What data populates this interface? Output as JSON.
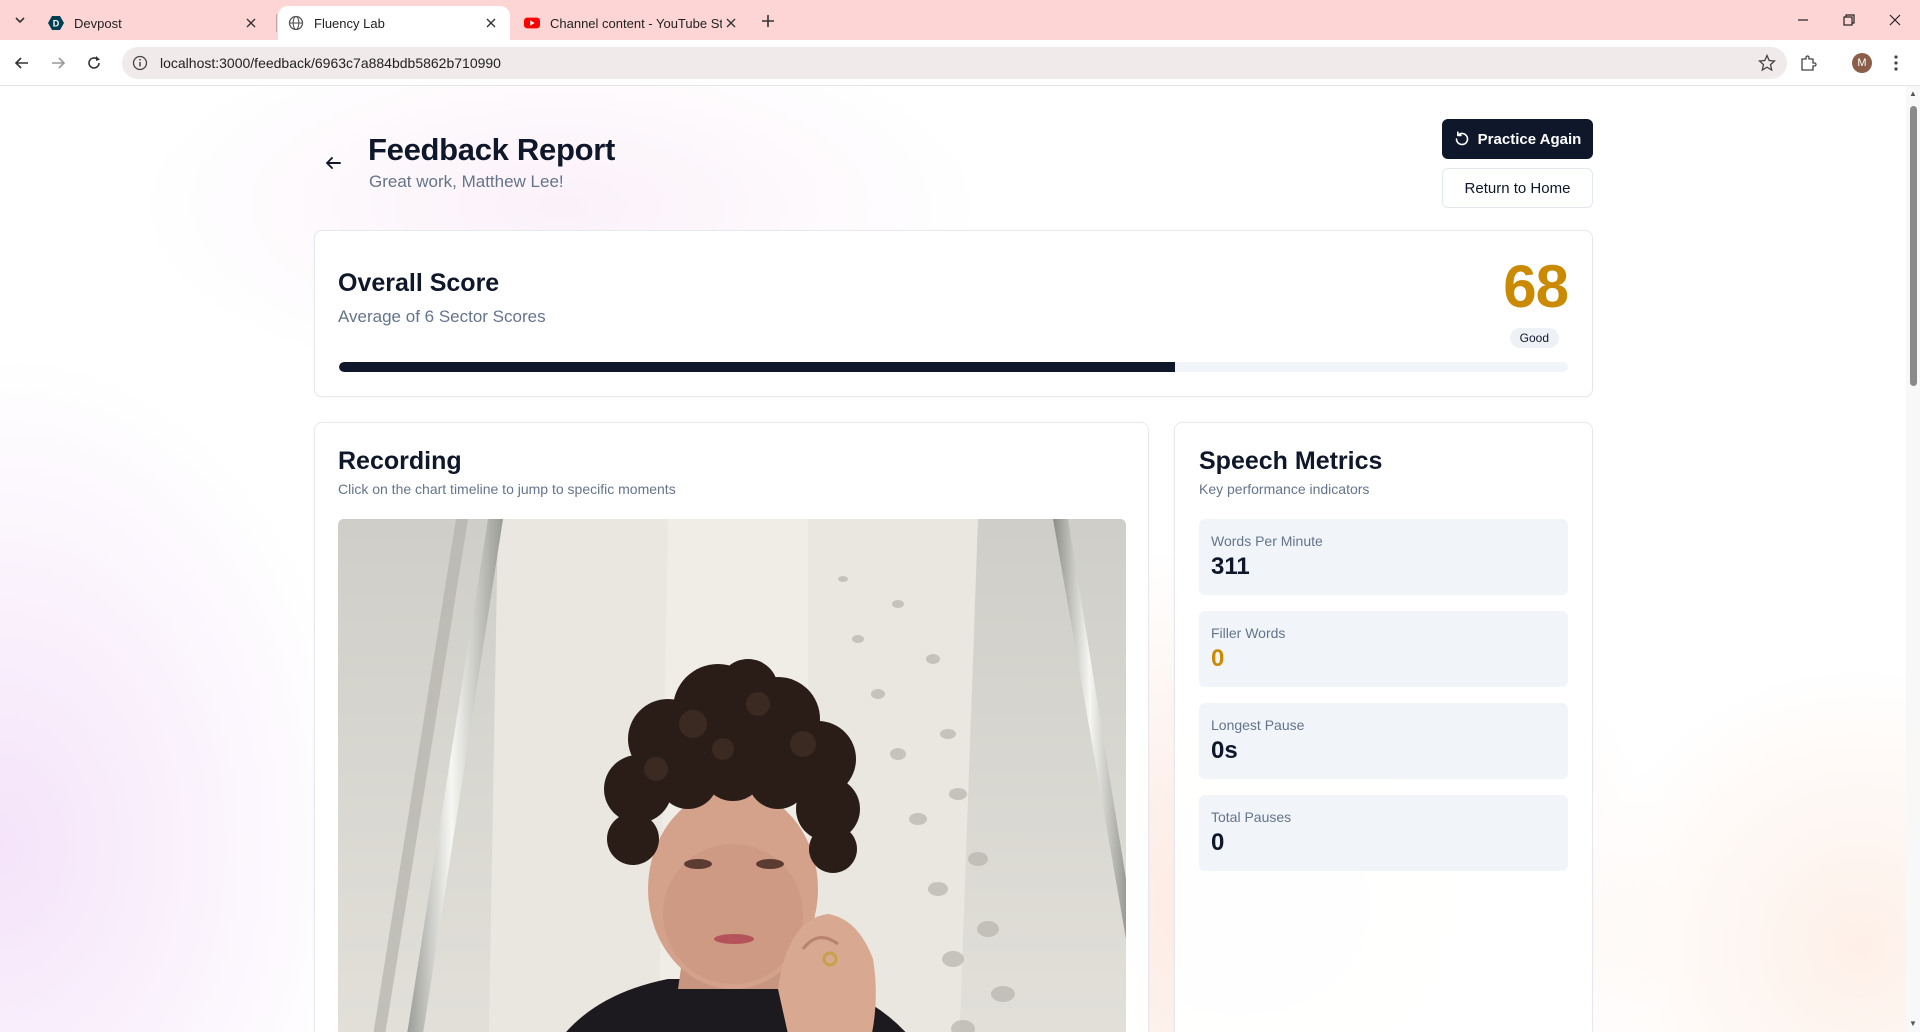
{
  "browser": {
    "tabs": [
      {
        "title": "Devpost",
        "favicon": "devpost-icon",
        "active": false
      },
      {
        "title": "Fluency Lab",
        "favicon": "globe-icon",
        "active": true
      },
      {
        "title": "Channel content - YouTube Stu",
        "favicon": "youtube-icon",
        "active": false
      }
    ],
    "url": "localhost:3000/feedback/6963c7a884bdb5862b710990",
    "profile_initial": "M"
  },
  "header": {
    "title": "Feedback Report",
    "subtitle": "Great work, Matthew Lee!",
    "practice_again_label": "Practice Again",
    "return_home_label": "Return to Home"
  },
  "overall": {
    "title": "Overall Score",
    "subtitle": "Average of 6 Sector Scores",
    "score": "68",
    "rating": "Good",
    "progress_percent": 68
  },
  "recording": {
    "title": "Recording",
    "subtitle": "Click on the chart timeline to jump to specific moments"
  },
  "metrics": {
    "title": "Speech Metrics",
    "subtitle": "Key performance indicators",
    "items": [
      {
        "label": "Words Per Minute",
        "value": "311"
      },
      {
        "label": "Filler Words",
        "value": "0"
      },
      {
        "label": "Longest Pause",
        "value": "0s"
      },
      {
        "label": "Total Pauses",
        "value": "0"
      }
    ]
  },
  "colors": {
    "primary": "#0f172a",
    "score_accent": "#ca8a04",
    "muted_text": "#64748b",
    "tabbar": "#fdd5d5"
  }
}
